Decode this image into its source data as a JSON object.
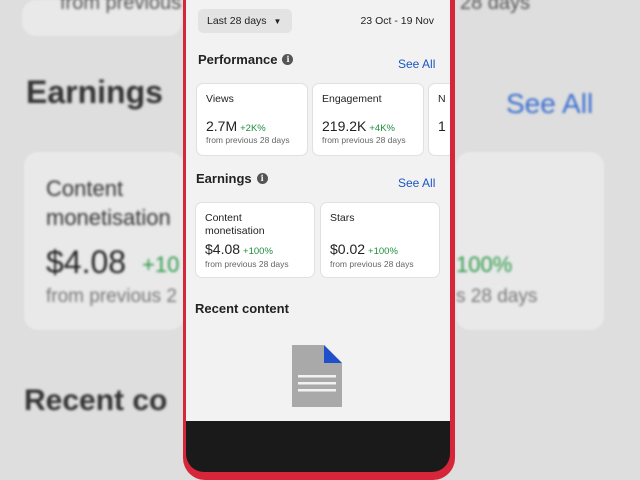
{
  "background": {
    "top_left_text": "from previous",
    "top_right_text": "28 days",
    "earnings_title": "Earnings",
    "see_all": "See All",
    "left_card_line1": "Content",
    "left_card_line2": "monetisation",
    "left_value": "$4.08",
    "left_delta": "+10",
    "left_sub": "from previous 2",
    "right_delta": "100%",
    "right_sub": "s 28 days",
    "recent": "Recent co"
  },
  "header": {
    "date_filter": "Last 28 days",
    "date_range": "23 Oct - 19 Nov"
  },
  "performance": {
    "title": "Performance",
    "see_all": "See All",
    "cards": [
      {
        "label": "Views",
        "value": "2.7M",
        "delta": "+2K%",
        "sub": "from previous 28 days"
      },
      {
        "label": "Engagement",
        "value": "219.2K",
        "delta": "+4K%",
        "sub": "from previous 28 days"
      },
      {
        "label": "N",
        "value": "1",
        "delta": "",
        "sub": ""
      }
    ]
  },
  "earnings": {
    "title": "Earnings",
    "see_all": "See All",
    "cards": [
      {
        "label": "Content monetisation",
        "value": "$4.08",
        "delta": "+100%",
        "sub": "from previous 28 days"
      },
      {
        "label": "Stars",
        "value": "$0.02",
        "delta": "+100%",
        "sub": "from previous 28 days"
      }
    ]
  },
  "recent": {
    "title": "Recent content"
  },
  "colors": {
    "link": "#1a55c4",
    "positive": "#1e8e3e",
    "phone_case": "#d7263a"
  }
}
